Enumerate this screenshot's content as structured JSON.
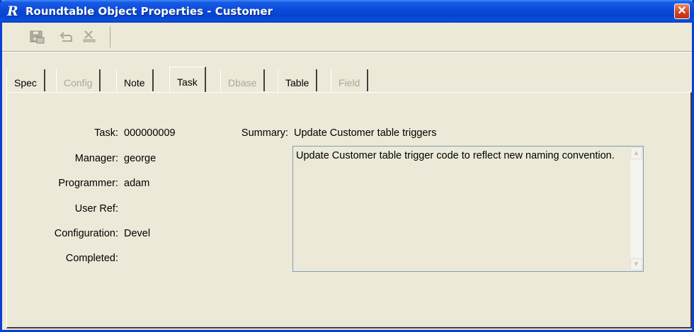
{
  "window": {
    "title": "Roundtable Object Properties - Customer",
    "app_icon_letter": "R",
    "close_glyph": "✕"
  },
  "toolbar": {
    "buttons": [
      {
        "icon": "save-icon",
        "enabled": false
      },
      {
        "icon": "undo-icon",
        "enabled": false
      },
      {
        "icon": "delete-icon",
        "enabled": false
      }
    ]
  },
  "tabs": [
    {
      "label": "Spec",
      "enabled": true,
      "active": false
    },
    {
      "label": "Config",
      "enabled": false,
      "active": false
    },
    {
      "label": "Note",
      "enabled": true,
      "active": false
    },
    {
      "label": "Task",
      "enabled": true,
      "active": true
    },
    {
      "label": "Dbase",
      "enabled": false,
      "active": false
    },
    {
      "label": "Table",
      "enabled": true,
      "active": false
    },
    {
      "label": "Field",
      "enabled": false,
      "active": false
    }
  ],
  "task": {
    "task_label": "Task:",
    "task_value": "000000009",
    "manager_label": "Manager:",
    "manager_value": "george",
    "programmer_label": "Programmer:",
    "programmer_value": "adam",
    "userref_label": "User Ref:",
    "userref_value": "",
    "configuration_label": "Configuration:",
    "configuration_value": "Devel",
    "completed_label": "Completed:",
    "completed_value": "",
    "summary_label": "Summary:",
    "summary_value": "Update Customer table triggers",
    "description": "Update Customer table trigger code to reflect new naming convention."
  },
  "colors": {
    "titlebar": "#0a4ad8",
    "face": "#ece9d8",
    "disabled_text": "#aca899",
    "close_button": "#d0401c"
  }
}
